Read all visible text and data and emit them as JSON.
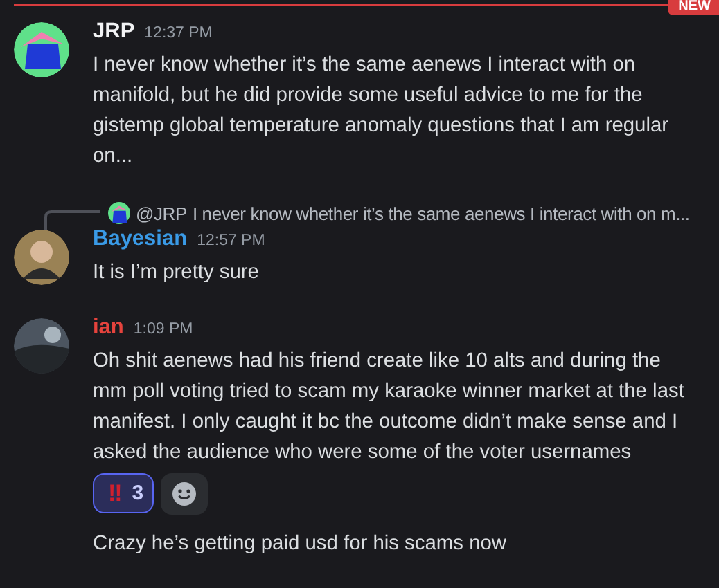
{
  "divider": {
    "badge": "NEW"
  },
  "messages": [
    {
      "kind": "full",
      "author": "JRP",
      "color": "#f2f3f5",
      "time": "12:37 PM",
      "text": "I never know whether it’s the same aenews I interact with on manifold, but he did provide some useful advice to me for the gistemp global temperature anomaly questions that I am regular on..."
    },
    {
      "kind": "full",
      "author": "Bayesian",
      "color": "#3a9ae6",
      "time": "12:57 PM",
      "reply": {
        "mention": "@JRP",
        "text": "I never know whether it’s the same aenews I interact with on m..."
      },
      "text": "It is I’m pretty sure"
    },
    {
      "kind": "full",
      "author": "ian",
      "color": "#e5433d",
      "time": "1:09 PM",
      "text": "Oh shit aenews had his friend create like 10 alts and during the mm poll voting tried to scam my karaoke winner market at the last manifest. I only caught it bc the outcome didn’t make sense and I asked the audience who were some of the voter usernames",
      "reactions": [
        {
          "emoji": "‼",
          "count": "3",
          "selected": true
        }
      ]
    },
    {
      "kind": "followup",
      "text": "Crazy he’s getting paid usd for his scams now"
    }
  ]
}
